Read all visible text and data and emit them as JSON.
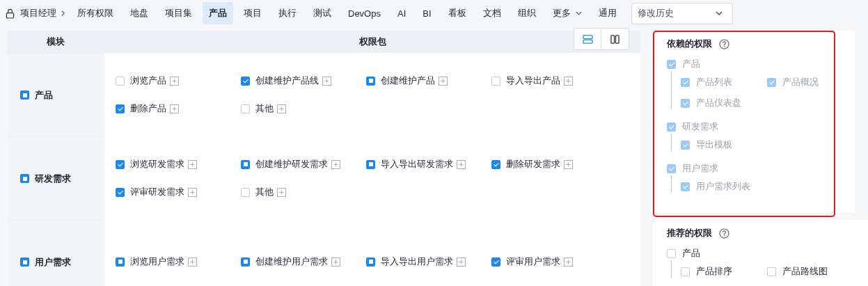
{
  "breadcrumb": {
    "label": "项目经理"
  },
  "nav_tabs": [
    {
      "label": "所有权限",
      "selected": false,
      "has_menu": false
    },
    {
      "label": "地盘",
      "selected": false,
      "has_menu": false
    },
    {
      "label": "项目集",
      "selected": false,
      "has_menu": false
    },
    {
      "label": "产品",
      "selected": true,
      "has_menu": false
    },
    {
      "label": "项目",
      "selected": false,
      "has_menu": false
    },
    {
      "label": "执行",
      "selected": false,
      "has_menu": false
    },
    {
      "label": "测试",
      "selected": false,
      "has_menu": false
    },
    {
      "label": "DevOps",
      "selected": false,
      "has_menu": false
    },
    {
      "label": "AI",
      "selected": false,
      "has_menu": false
    },
    {
      "label": "BI",
      "selected": false,
      "has_menu": false
    },
    {
      "label": "看板",
      "selected": false,
      "has_menu": false
    },
    {
      "label": "文档",
      "selected": false,
      "has_menu": false
    },
    {
      "label": "组织",
      "selected": false,
      "has_menu": false
    },
    {
      "label": "更多",
      "selected": false,
      "has_menu": true
    },
    {
      "label": "通用",
      "selected": false,
      "has_menu": false
    }
  ],
  "history_select": {
    "value": "修改历史"
  },
  "table": {
    "columns": [
      "模块",
      "权限包"
    ],
    "view_toggle": [
      {
        "kind": "rows",
        "selected": true
      },
      {
        "kind": "columns",
        "selected": false
      }
    ],
    "rows": [
      {
        "module": "产品",
        "checked": false,
        "partial": true,
        "permissions": [
          {
            "label": "浏览产品",
            "checked": false,
            "partial": false
          },
          {
            "label": "创建维护产品线",
            "checked": true,
            "partial": false
          },
          {
            "label": "创建维护产品",
            "checked": false,
            "partial": true
          },
          {
            "label": "导入导出产品",
            "checked": false,
            "partial": false
          },
          {
            "label": "删除产品",
            "checked": true,
            "partial": false
          },
          {
            "label": "其他",
            "checked": false,
            "partial": false
          }
        ]
      },
      {
        "module": "研发需求",
        "checked": false,
        "partial": true,
        "permissions": [
          {
            "label": "浏览研发需求",
            "checked": true,
            "partial": false
          },
          {
            "label": "创建维护研发需求",
            "checked": false,
            "partial": true
          },
          {
            "label": "导入导出研发需求",
            "checked": false,
            "partial": true
          },
          {
            "label": "删除研发需求",
            "checked": true,
            "partial": false
          },
          {
            "label": "评审研发需求",
            "checked": true,
            "partial": false
          },
          {
            "label": "其他",
            "checked": false,
            "partial": false
          }
        ]
      },
      {
        "module": "用户需求",
        "checked": false,
        "partial": true,
        "permissions": [
          {
            "label": "浏览用户需求",
            "checked": false,
            "partial": true
          },
          {
            "label": "创建维护用户需求",
            "checked": false,
            "partial": true
          },
          {
            "label": "导入导出用户需求",
            "checked": false,
            "partial": true
          },
          {
            "label": "评审用户需求",
            "checked": true,
            "partial": false
          }
        ]
      }
    ]
  },
  "dependency_panel": {
    "title": "依赖的权限",
    "highlighted": true,
    "groups": [
      {
        "label": "产品",
        "checked": true,
        "disabled": true,
        "children": [
          {
            "label": "产品列表",
            "checked": true,
            "disabled": true
          },
          {
            "label": "产品概况",
            "checked": true,
            "disabled": true
          },
          {
            "label": "产品仪表盘",
            "checked": true,
            "disabled": true
          }
        ]
      },
      {
        "label": "研发需求",
        "checked": true,
        "disabled": true,
        "children": [
          {
            "label": "导出模板",
            "checked": true,
            "disabled": true
          }
        ]
      },
      {
        "label": "用户需求",
        "checked": true,
        "disabled": true,
        "children": [
          {
            "label": "用户需求列表",
            "checked": true,
            "disabled": true
          }
        ]
      }
    ]
  },
  "recommended_panel": {
    "title": "推荐的权限",
    "highlighted": false,
    "groups": [
      {
        "label": "产品",
        "checked": false,
        "disabled": false,
        "children": [
          {
            "label": "产品排序",
            "checked": false,
            "disabled": false
          },
          {
            "label": "产品路线图",
            "checked": false,
            "disabled": false
          }
        ]
      }
    ]
  }
}
